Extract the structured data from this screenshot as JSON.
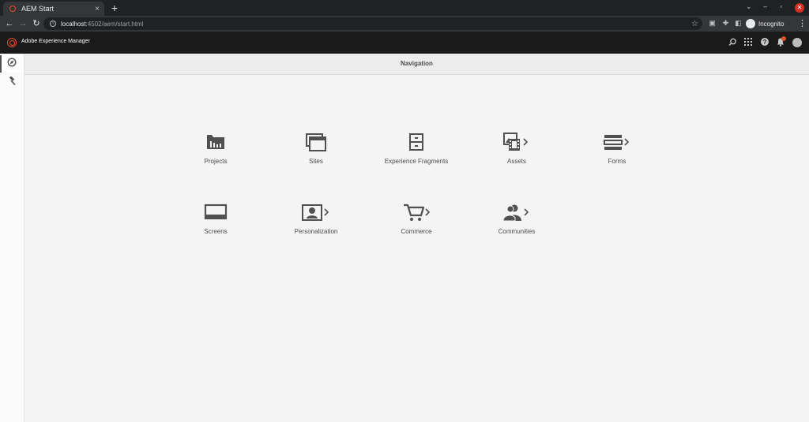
{
  "browser": {
    "tab_title": "AEM Start",
    "tab_close": "×",
    "new_tab": "+",
    "url_host": "localhost",
    "url_path": ":4502/aem/start.html",
    "profile_label": "Incognito"
  },
  "header": {
    "app_title": "Adobe Experience Manager"
  },
  "navigation": {
    "title": "Navigation"
  },
  "tiles": [
    {
      "label": "Projects",
      "has_children": false
    },
    {
      "label": "Sites",
      "has_children": false
    },
    {
      "label": "Experience Fragments",
      "has_children": false
    },
    {
      "label": "Assets",
      "has_children": true
    },
    {
      "label": "Forms",
      "has_children": true
    },
    {
      "label": "Screens",
      "has_children": false
    },
    {
      "label": "Personalization",
      "has_children": true
    },
    {
      "label": "Commerce",
      "has_children": true
    },
    {
      "label": "Communities",
      "has_children": true
    }
  ],
  "colors": {
    "brand": "#e34f26",
    "icon": "#505050",
    "header_bg": "#1a1a1a",
    "page_bg": "#f4f4f4"
  },
  "icons": {
    "rail": [
      "compass-icon",
      "hammer-icon"
    ],
    "header": [
      "search-icon",
      "apps-grid-icon",
      "help-icon",
      "bell-icon",
      "user-avatar"
    ]
  }
}
